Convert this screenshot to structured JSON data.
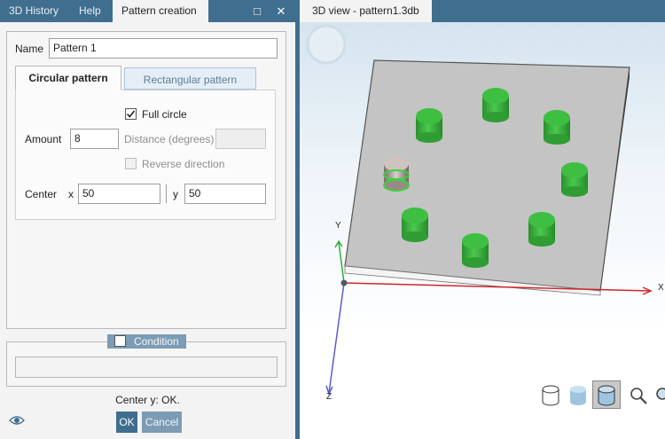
{
  "left_tabs": [
    {
      "label": "3D History"
    },
    {
      "label": "Help"
    },
    {
      "label": "Pattern creation"
    }
  ],
  "window_buttons": {
    "maximize": "□",
    "close": "✕"
  },
  "form": {
    "name_label": "Name",
    "name_value": "Pattern 1",
    "tabs": [
      {
        "label": "Circular pattern",
        "active": true
      },
      {
        "label": "Rectangular pattern",
        "active": false
      }
    ],
    "full_circle_label": "Full circle",
    "full_circle_checked": true,
    "amount_label": "Amount",
    "amount_value": "8",
    "distance_label": "Distance (degrees)",
    "distance_value": "",
    "reverse_label": "Reverse direction",
    "reverse_checked": false,
    "center_label": "Center",
    "x_label": "x",
    "x_value": "50",
    "y_label": "y",
    "y_value": "50"
  },
  "condition": {
    "label": "Condition",
    "checked": false,
    "value": ""
  },
  "status_text": "Center y: OK.",
  "buttons": {
    "ok": "OK",
    "cancel": "Cancel"
  },
  "view": {
    "tab_label": "3D view - pattern1.3db",
    "axes": {
      "x": "X",
      "y": "Y",
      "z": "Z"
    },
    "axis_colors": {
      "x": "#d0262b",
      "y": "#2fae3b",
      "z": "#5b5bd0"
    },
    "cylinder_count": 8,
    "cylinder_color": "#37b23a",
    "selected_cylinder_color": "#9a8a86",
    "plate_color": "#c4c4c4",
    "toolbar_icons": [
      "wireframe-icon",
      "shaded-icon",
      "shaded-edges-icon",
      "zoom-icon",
      "zoom-all-icon"
    ]
  },
  "colors": {
    "accent": "#3f6e8f"
  }
}
